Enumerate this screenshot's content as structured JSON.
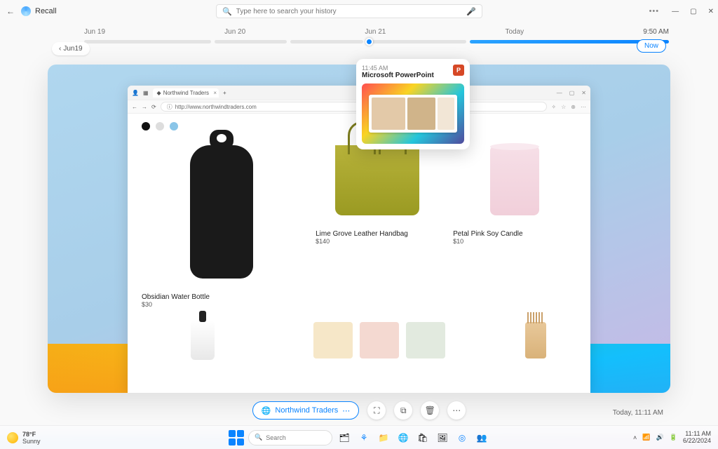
{
  "recall": {
    "title": "Recall",
    "search_placeholder": "Type here to search your history",
    "back_pill": "Jun19",
    "timeline": [
      "Jun 19",
      "Jun 20",
      "Jun 21",
      "Today",
      "9:50 AM"
    ],
    "now": "Now"
  },
  "preview": {
    "time": "11:45 AM",
    "app": "Microsoft PowerPoint",
    "badge": "P"
  },
  "browser": {
    "tab": "Northwind Traders",
    "url": "http://www.northwindtraders.com"
  },
  "products": {
    "bottle": {
      "name": "Obsidian  Water Bottle",
      "price": "$30"
    },
    "bag": {
      "name": "Lime Grove Leather Handbag",
      "price": "$140"
    },
    "candle": {
      "name": "Petal Pink Soy Candle",
      "price": "$10"
    }
  },
  "actionbar": {
    "source": "Northwind Traders"
  },
  "timestamp": "Today, 11:11 AM",
  "taskbar": {
    "temp": "78°F",
    "cond": "Sunny",
    "search": "Search",
    "time": "11:11 AM",
    "date": "6/22/2024"
  }
}
